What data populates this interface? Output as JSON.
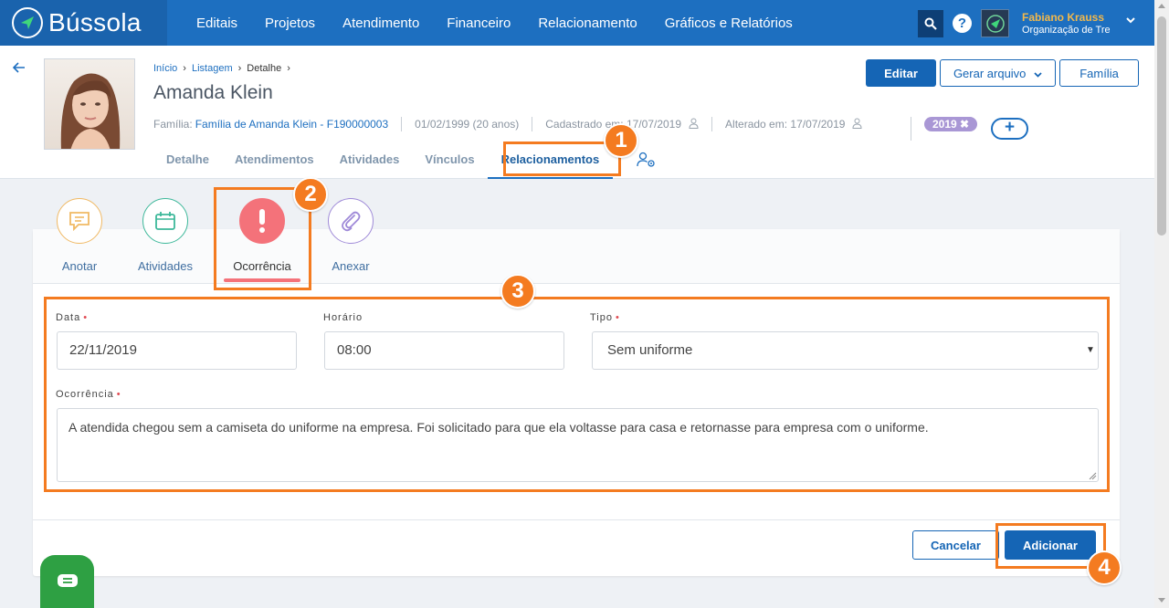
{
  "nav": {
    "logo": "Bússola",
    "links": [
      "Editais",
      "Projetos",
      "Atendimento",
      "Financeiro",
      "Relacionamento",
      "Gráficos e Relatórios"
    ],
    "help": "?",
    "user_name": "Fabiano Krauss",
    "user_org": "Organização de Tre"
  },
  "header": {
    "breadcrumb": [
      "Início",
      "Listagem",
      "Detalhe"
    ],
    "person_name": "Amanda Klein",
    "family_label": "Família:",
    "family_value": "Família de Amanda Klein - F190000003",
    "birth": "01/02/1999 (20 anos)",
    "created": "Cadastrado em: 17/07/2019",
    "updated": "Alterado em: 17/07/2019",
    "tag": "2019",
    "add_tag": "+",
    "buttons": {
      "edit": "Editar",
      "generate": "Gerar arquivo",
      "family": "Família"
    },
    "tabs": [
      "Detalhe",
      "Atendimentos",
      "Atividades",
      "Vínculos",
      "Relacionamentos"
    ]
  },
  "activities": [
    "Anotar",
    "Atividades",
    "Ocorrência",
    "Anexar"
  ],
  "form": {
    "date_label": "Data",
    "date_value": "22/11/2019",
    "time_label": "Horário",
    "time_value": "08:00",
    "type_label": "Tipo",
    "type_value": "Sem uniforme",
    "occurrence_label": "Ocorrência",
    "occurrence_value": "A atendida chegou sem a camiseta do uniforme na empresa. Foi solicitado para que ela voltasse para casa e retornasse para empresa com o uniforme.",
    "required_mark": "•",
    "cancel": "Cancelar",
    "add": "Adicionar"
  },
  "annotations": [
    "1",
    "2",
    "3",
    "4"
  ],
  "colors": {
    "primary": "#1565b5",
    "nav": "#1d6fc0",
    "highlight": "#f47b20",
    "occurrence": "#f4727a",
    "chat": "#2ea043"
  }
}
